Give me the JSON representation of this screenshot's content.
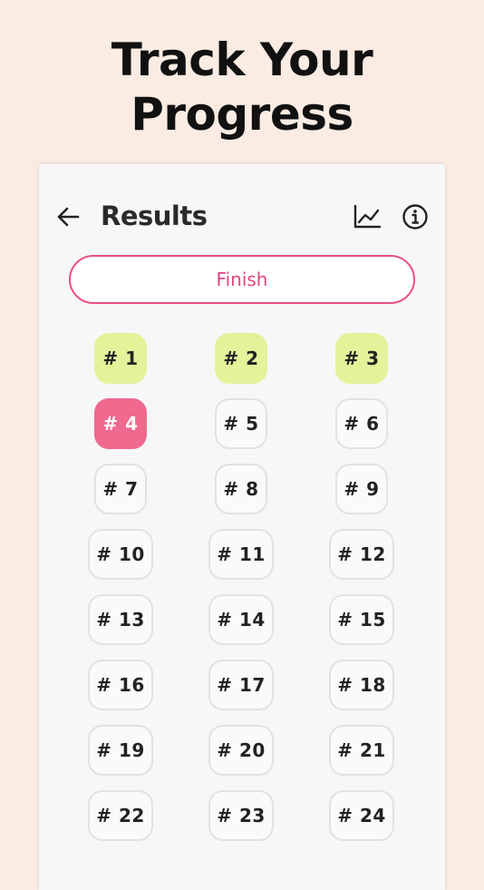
{
  "promo": {
    "line1": "Track Your",
    "line2": "Progress"
  },
  "header": {
    "title": "Results",
    "back_icon": "arrow-left-icon",
    "chart_icon": "line-chart-icon",
    "info_icon": "info-circle-icon"
  },
  "finish_label": "Finish",
  "colors": {
    "background": "#fbece3",
    "accent_pink": "#e94f86",
    "completed": "#e4f29a",
    "current": "#f0698f"
  },
  "rounds": [
    {
      "label": "# 1",
      "state": "completed"
    },
    {
      "label": "# 2",
      "state": "completed"
    },
    {
      "label": "# 3",
      "state": "completed"
    },
    {
      "label": "# 4",
      "state": "current"
    },
    {
      "label": "# 5",
      "state": "pending"
    },
    {
      "label": "# 6",
      "state": "pending"
    },
    {
      "label": "# 7",
      "state": "pending"
    },
    {
      "label": "# 8",
      "state": "pending"
    },
    {
      "label": "# 9",
      "state": "pending"
    },
    {
      "label": "# 10",
      "state": "pending"
    },
    {
      "label": "# 11",
      "state": "pending"
    },
    {
      "label": "# 12",
      "state": "pending"
    },
    {
      "label": "# 13",
      "state": "pending"
    },
    {
      "label": "# 14",
      "state": "pending"
    },
    {
      "label": "# 15",
      "state": "pending"
    },
    {
      "label": "# 16",
      "state": "pending"
    },
    {
      "label": "# 17",
      "state": "pending"
    },
    {
      "label": "# 18",
      "state": "pending"
    },
    {
      "label": "# 19",
      "state": "pending"
    },
    {
      "label": "# 20",
      "state": "pending"
    },
    {
      "label": "# 21",
      "state": "pending"
    },
    {
      "label": "# 22",
      "state": "pending"
    },
    {
      "label": "# 23",
      "state": "pending"
    },
    {
      "label": "# 24",
      "state": "pending"
    }
  ]
}
